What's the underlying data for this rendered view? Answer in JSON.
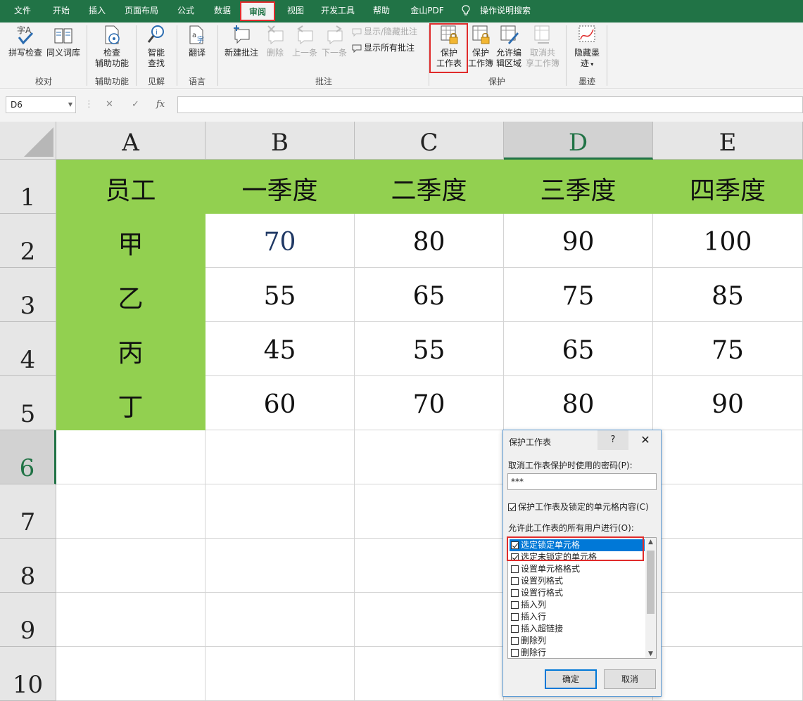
{
  "ribbon_tabs": [
    {
      "label": "文件"
    },
    {
      "label": "开始"
    },
    {
      "label": "插入"
    },
    {
      "label": "页面布局"
    },
    {
      "label": "公式"
    },
    {
      "label": "数据"
    },
    {
      "label": "审阅",
      "active": true
    },
    {
      "label": "视图"
    },
    {
      "label": "开发工具"
    },
    {
      "label": "帮助"
    },
    {
      "label": "金山PDF"
    },
    {
      "label": "操作说明搜索",
      "icon": "lightbulb-icon"
    }
  ],
  "ribbon": {
    "proofing": {
      "group_label": "校对",
      "spell_check": "拼写检查",
      "thesaurus": "同义词库"
    },
    "accessibility": {
      "group_label": "辅助功能",
      "check_line1": "检查",
      "check_line2": "辅助功能"
    },
    "insights": {
      "group_label": "见解",
      "line1": "智能",
      "line2": "查找"
    },
    "language": {
      "group_label": "语言",
      "translate": "翻译"
    },
    "comments": {
      "group_label": "批注",
      "new_comment": "新建批注",
      "delete": "删除",
      "previous": "上一条",
      "next": "下一条",
      "show_hide": "显示/隐藏批注",
      "show_all": "显示所有批注"
    },
    "protect": {
      "group_label": "保护",
      "protect_sheet_line1": "保护",
      "protect_sheet_line2": "工作表",
      "protect_workbook_line1": "保护",
      "protect_workbook_line2": "工作簿",
      "allow_edit_line1": "允许编",
      "allow_edit_line2": "辑区域",
      "unshare_line1": "取消共",
      "unshare_line2": "享工作簿"
    },
    "ink": {
      "group_label": "墨迹",
      "hide_ink_line1": "隐藏墨",
      "hide_ink_line2": "迹"
    }
  },
  "formula_bar": {
    "name_box": "D6",
    "formula": "",
    "fx": "fx"
  },
  "columns": [
    "A",
    "B",
    "C",
    "D",
    "E"
  ],
  "rows": [
    "1",
    "2",
    "3",
    "4",
    "5",
    "6",
    "7",
    "8",
    "9",
    "10"
  ],
  "sheet": {
    "header": [
      "员工",
      "一季度",
      "二季度",
      "三季度",
      "四季度"
    ],
    "data": [
      [
        "甲",
        "70",
        "80",
        "90",
        "100"
      ],
      [
        "乙",
        "55",
        "65",
        "75",
        "85"
      ],
      [
        "丙",
        "45",
        "55",
        "65",
        "75"
      ],
      [
        "丁",
        "60",
        "70",
        "80",
        "90"
      ]
    ]
  },
  "dialog": {
    "title": "保护工作表",
    "help": "?",
    "close": "✕",
    "password_label": "取消工作表保护时使用的密码(P):",
    "password_value": "***",
    "protect_checkbox_label": "保护工作表及锁定的单元格内容(C)",
    "protect_checked": true,
    "allow_label": "允许此工作表的所有用户进行(O):",
    "permissions": [
      {
        "label": "选定锁定单元格",
        "checked": true
      },
      {
        "label": "选定未锁定的单元格",
        "checked": true
      },
      {
        "label": "设置单元格格式",
        "checked": false
      },
      {
        "label": "设置列格式",
        "checked": false
      },
      {
        "label": "设置行格式",
        "checked": false
      },
      {
        "label": "插入列",
        "checked": false
      },
      {
        "label": "插入行",
        "checked": false
      },
      {
        "label": "插入超链接",
        "checked": false
      },
      {
        "label": "删除列",
        "checked": false
      },
      {
        "label": "删除行",
        "checked": false
      }
    ],
    "ok": "确定",
    "cancel": "取消"
  },
  "colors": {
    "accent": "#217346",
    "header_fill": "#92d050",
    "highlight": "#e02b2b",
    "selection": "#0078d7"
  }
}
